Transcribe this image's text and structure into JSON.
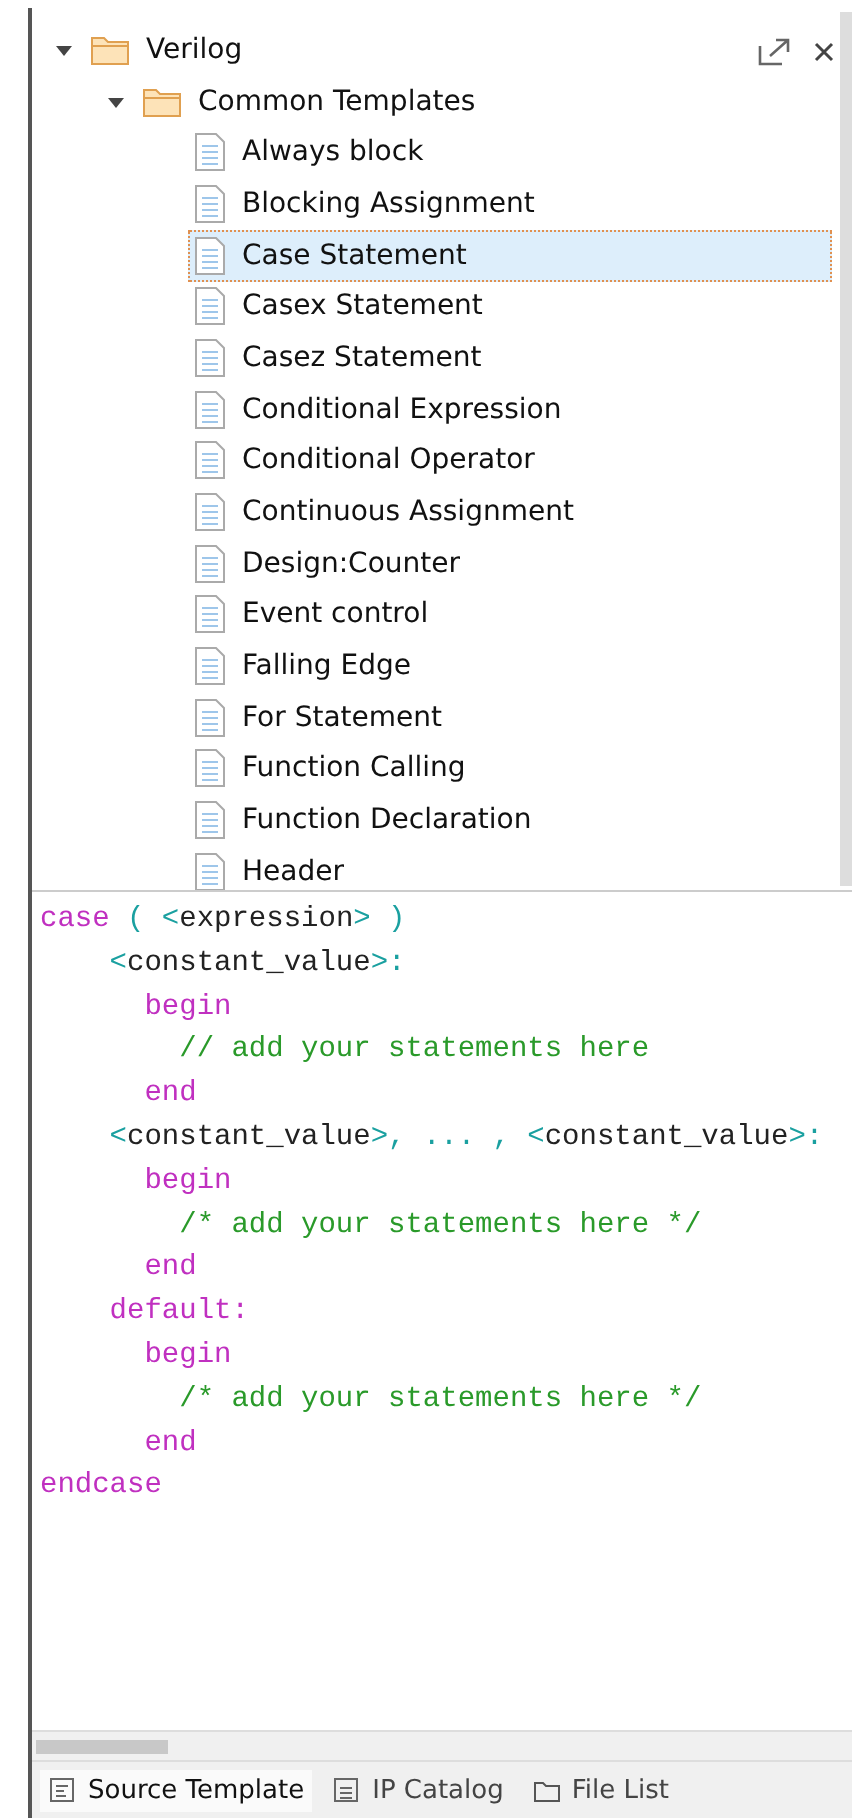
{
  "tree": [
    {
      "label": "Verilog",
      "kind": "folder",
      "expanded": true,
      "selected": false,
      "children": [
        {
          "label": "Common Templates",
          "kind": "folder",
          "expanded": true,
          "selected": false,
          "children": [
            {
              "label": "Always block",
              "kind": "file",
              "selected": false
            },
            {
              "label": "Blocking Assignment",
              "kind": "file",
              "selected": false
            },
            {
              "label": "Case Statement",
              "kind": "file",
              "selected": true
            },
            {
              "label": "Casex Statement",
              "kind": "file",
              "selected": false
            },
            {
              "label": "Casez Statement",
              "kind": "file",
              "selected": false
            },
            {
              "label": "Conditional Expression",
              "kind": "file",
              "selected": false
            },
            {
              "label": "Conditional Operator",
              "kind": "file",
              "selected": false
            },
            {
              "label": "Continuous Assignment",
              "kind": "file",
              "selected": false
            },
            {
              "label": "Design:Counter",
              "kind": "file",
              "selected": false
            },
            {
              "label": "Event control",
              "kind": "file",
              "selected": false
            },
            {
              "label": "Falling Edge",
              "kind": "file",
              "selected": false
            },
            {
              "label": "For Statement",
              "kind": "file",
              "selected": false
            },
            {
              "label": "Function Calling",
              "kind": "file",
              "selected": false
            },
            {
              "label": "Function Declaration",
              "kind": "file",
              "selected": false
            },
            {
              "label": "Header",
              "kind": "file",
              "selected": false
            }
          ]
        }
      ]
    }
  ],
  "code": [
    [
      {
        "text": "case",
        "kind": "keyword"
      },
      {
        "text": " ( <",
        "kind": "punct"
      },
      {
        "text": "expression",
        "kind": "ident"
      },
      {
        "text": "> )",
        "kind": "punct"
      }
    ],
    [
      {
        "text": "    <",
        "kind": "punct"
      },
      {
        "text": "constant_value",
        "kind": "ident"
      },
      {
        "text": ">:",
        "kind": "punct"
      }
    ],
    [
      {
        "text": "      begin",
        "kind": "keyword"
      }
    ],
    [
      {
        "text": "        // add your statements here",
        "kind": "comment"
      }
    ],
    [
      {
        "text": "      end",
        "kind": "keyword"
      }
    ],
    [
      {
        "text": "    <",
        "kind": "punct"
      },
      {
        "text": "constant_value",
        "kind": "ident"
      },
      {
        "text": ">, ... , <",
        "kind": "punct"
      },
      {
        "text": "constant_value",
        "kind": "ident"
      },
      {
        "text": ">:",
        "kind": "punct"
      }
    ],
    [
      {
        "text": "      begin",
        "kind": "keyword"
      }
    ],
    [
      {
        "text": "        /* add your statements here */",
        "kind": "comment"
      }
    ],
    [
      {
        "text": "      end",
        "kind": "keyword"
      }
    ],
    [
      {
        "text": "    default:",
        "kind": "keyword"
      }
    ],
    [
      {
        "text": "      begin",
        "kind": "keyword"
      }
    ],
    [
      {
        "text": "        /* add your statements here */",
        "kind": "comment"
      }
    ],
    [
      {
        "text": "      end",
        "kind": "keyword"
      }
    ],
    [
      {
        "text": "endcase",
        "kind": "keyword"
      }
    ]
  ],
  "tabs": [
    {
      "label": "Source Template",
      "kind": "template",
      "selected": true
    },
    {
      "label": "IP Catalog",
      "kind": "catalog",
      "selected": false
    },
    {
      "label": "File List",
      "kind": "folder",
      "selected": false
    }
  ]
}
